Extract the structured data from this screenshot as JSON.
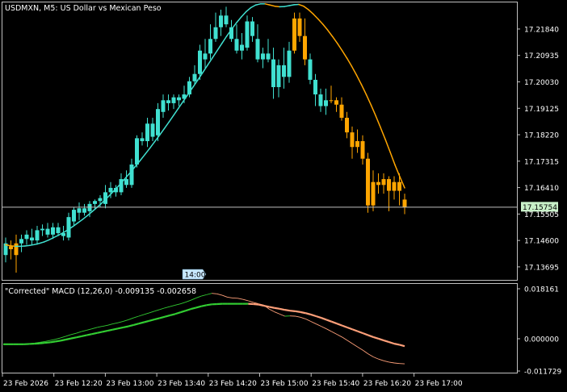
{
  "chart": {
    "title": "USDMXN, M5:  US Dollar vs Mexican Peso",
    "current_price_label": "17.15754",
    "current_price": 17.15754,
    "crosshair_time_label": "14:00",
    "price_ticks": [
      "17.21840",
      "17.20935",
      "17.20030",
      "17.19125",
      "17.18220",
      "17.17315",
      "17.16410",
      "17.15505",
      "17.14600",
      "17.13695"
    ],
    "time_ticks": [
      "23 Feb 2026",
      "23 Feb 12:20",
      "23 Feb 13:00",
      "23 Feb 13:40",
      "23 Feb 14:20",
      "23 Feb 15:00",
      "23 Feb 15:40",
      "23 Feb 16:20",
      "23 Feb 17:00"
    ]
  },
  "indicator": {
    "title": "\"Corrected\" MACD (12,26,0) -0.009135 -0.002658",
    "ticks": [
      "0.018161",
      "0.000000",
      "-0.011729"
    ]
  },
  "colors": {
    "background": "#000000",
    "bull": "#40e0d0",
    "bear": "#ffa500",
    "macd_line_up": "#32cd32",
    "macd_line_down": "#ffa07a",
    "border": "#c0c0c0",
    "price_label_bg": "#c8f0c8"
  },
  "chart_data": {
    "type": "candlestick",
    "price_range": [
      17.1325,
      17.2275
    ],
    "candles_ohlc": [
      [
        17.145,
        17.147,
        17.1385,
        17.141
      ],
      [
        17.144,
        17.146,
        17.1395,
        17.143
      ],
      [
        17.141,
        17.148,
        17.135,
        17.145
      ],
      [
        17.145,
        17.148,
        17.142,
        17.1465
      ],
      [
        17.1465,
        17.1495,
        17.1445,
        17.148
      ],
      [
        17.147,
        17.15,
        17.1445,
        17.146
      ],
      [
        17.146,
        17.151,
        17.1445,
        17.1495
      ],
      [
        17.1495,
        17.1515,
        17.1475,
        17.15
      ],
      [
        17.15,
        17.152,
        17.147,
        17.148
      ],
      [
        17.148,
        17.152,
        17.1465,
        17.1505
      ],
      [
        17.1505,
        17.152,
        17.1475,
        17.1485
      ],
      [
        17.1485,
        17.151,
        17.146,
        17.1475
      ],
      [
        17.147,
        17.1555,
        17.146,
        17.154
      ],
      [
        17.1525,
        17.1575,
        17.151,
        17.1565
      ],
      [
        17.1555,
        17.159,
        17.153,
        17.157
      ],
      [
        17.157,
        17.1585,
        17.1545,
        17.1555
      ],
      [
        17.156,
        17.1595,
        17.154,
        17.1585
      ],
      [
        17.1585,
        17.16,
        17.1565,
        17.1595
      ],
      [
        17.1595,
        17.1615,
        17.1575,
        17.1605
      ],
      [
        17.1585,
        17.165,
        17.157,
        17.1625
      ],
      [
        17.1625,
        17.166,
        17.1605,
        17.164
      ],
      [
        17.164,
        17.165,
        17.161,
        17.1625
      ],
      [
        17.1625,
        17.169,
        17.1615,
        17.167
      ],
      [
        17.167,
        17.17,
        17.164,
        17.165
      ],
      [
        17.165,
        17.174,
        17.164,
        17.172
      ],
      [
        17.172,
        17.182,
        17.171,
        17.181
      ],
      [
        17.181,
        17.183,
        17.1785,
        17.18
      ],
      [
        17.18,
        17.188,
        17.178,
        17.186
      ],
      [
        17.186,
        17.188,
        17.18,
        17.1815
      ],
      [
        17.182,
        17.193,
        17.18,
        17.191
      ],
      [
        17.19,
        17.196,
        17.188,
        17.194
      ],
      [
        17.194,
        17.196,
        17.1905,
        17.193
      ],
      [
        17.193,
        17.196,
        17.191,
        17.195
      ],
      [
        17.195,
        17.196,
        17.192,
        17.194
      ],
      [
        17.1945,
        17.199,
        17.193,
        17.196
      ],
      [
        17.196,
        17.202,
        17.195,
        17.2005
      ],
      [
        17.2005,
        17.206,
        17.1995,
        17.203
      ],
      [
        17.203,
        17.213,
        17.201,
        17.211
      ],
      [
        17.208,
        17.215,
        17.205,
        17.21
      ],
      [
        17.21,
        17.22,
        17.208,
        17.215
      ],
      [
        17.215,
        17.224,
        17.214,
        17.219
      ],
      [
        17.219,
        17.225,
        17.216,
        17.223
      ],
      [
        17.223,
        17.226,
        17.219,
        17.22
      ],
      [
        17.219,
        17.2215,
        17.214,
        17.215
      ],
      [
        17.215,
        17.22,
        17.21,
        17.211
      ],
      [
        17.211,
        17.217,
        17.208,
        17.213
      ],
      [
        17.212,
        17.223,
        17.211,
        17.221
      ],
      [
        17.221,
        17.2225,
        17.214,
        17.216
      ],
      [
        17.215,
        17.22,
        17.207,
        17.208
      ],
      [
        17.208,
        17.212,
        17.205,
        17.21
      ],
      [
        17.21,
        17.215,
        17.207,
        17.208
      ],
      [
        17.208,
        17.212,
        17.1945,
        17.1985
      ],
      [
        17.1985,
        17.208,
        17.195,
        17.206
      ],
      [
        17.206,
        17.212,
        17.198,
        17.202
      ],
      [
        17.202,
        17.214,
        17.2,
        17.211
      ],
      [
        17.211,
        17.224,
        17.21,
        17.222
      ],
      [
        17.222,
        17.224,
        17.214,
        17.216
      ],
      [
        17.216,
        17.222,
        17.206,
        17.208
      ],
      [
        17.208,
        17.21,
        17.1995,
        17.201
      ],
      [
        17.201,
        17.203,
        17.192,
        17.196
      ],
      [
        17.196,
        17.198,
        17.19,
        17.192
      ],
      [
        17.192,
        17.198,
        17.189,
        17.194
      ],
      [
        17.194,
        17.199,
        17.193,
        17.194
      ],
      [
        17.194,
        17.195,
        17.19,
        17.1925
      ],
      [
        17.1925,
        17.195,
        17.187,
        17.188
      ],
      [
        17.188,
        17.19,
        17.181,
        17.183
      ],
      [
        17.183,
        17.185,
        17.174,
        17.178
      ],
      [
        17.178,
        17.184,
        17.176,
        17.18
      ],
      [
        17.18,
        17.182,
        17.172,
        17.174
      ],
      [
        17.174,
        17.176,
        17.1555,
        17.158
      ],
      [
        17.158,
        17.17,
        17.156,
        17.166
      ],
      [
        17.166,
        17.169,
        17.162,
        17.165
      ],
      [
        17.165,
        17.169,
        17.162,
        17.167
      ],
      [
        17.167,
        17.168,
        17.156,
        17.163
      ],
      [
        17.163,
        17.168,
        17.16,
        17.166
      ],
      [
        17.166,
        17.169,
        17.158,
        17.163
      ],
      [
        17.16,
        17.162,
        17.155,
        17.1575
      ]
    ],
    "ma_values": [
      17.1445,
      17.1442,
      17.144,
      17.144,
      17.1441,
      17.1443,
      17.1446,
      17.145,
      17.1455,
      17.1462,
      17.147,
      17.1478,
      17.1487,
      17.1497,
      17.1508,
      17.152,
      17.1532,
      17.1545,
      17.1559,
      17.1573,
      17.1588,
      17.1604,
      17.1621,
      17.1638,
      17.1656,
      17.1675,
      17.1694,
      17.1714,
      17.1734,
      17.1755,
      17.1776,
      17.1798,
      17.182,
      17.1843,
      17.1866,
      17.189,
      17.1914,
      17.1938,
      17.1962,
      17.1986,
      17.201,
      17.2035,
      17.206,
      17.2085,
      17.211,
      17.2135,
      17.216,
      17.2183,
      17.2205,
      17.2225,
      17.2243,
      17.2257,
      17.2266,
      17.227,
      17.227,
      17.2266,
      17.2262,
      17.226,
      17.2261,
      17.2264,
      17.2267,
      17.2268,
      17.2262,
      17.225,
      17.2235,
      17.2218,
      17.22,
      17.218,
      17.2158,
      17.2135,
      17.211,
      17.2084,
      17.2056,
      17.2026,
      17.1994,
      17.196,
      17.1924,
      17.1886,
      17.1846,
      17.1805,
      17.1762,
      17.1718,
      17.1678,
      17.164
    ],
    "macd_range": [
      -0.011729,
      0.018161
    ],
    "macd_line": [
      -0.002,
      -0.002,
      -0.002,
      -0.002,
      -0.0019,
      -0.0018,
      -0.0016,
      -0.0013,
      -0.001,
      -0.0006,
      -0.0002,
      0.0003,
      0.0009,
      0.0015,
      0.002,
      0.0026,
      0.0031,
      0.0036,
      0.0041,
      0.0045,
      0.0049,
      0.0054,
      0.0058,
      0.0063,
      0.0069,
      0.0076,
      0.0082,
      0.0088,
      0.0094,
      0.01,
      0.0106,
      0.0112,
      0.0117,
      0.0122,
      0.0127,
      0.0133,
      0.014,
      0.0148,
      0.0155,
      0.016,
      0.0165,
      0.0163,
      0.0158,
      0.0151,
      0.0148,
      0.0147,
      0.0143,
      0.0138,
      0.0132,
      0.0127,
      0.0122,
      0.0108,
      0.0098,
      0.009,
      0.0082,
      0.0083,
      0.0082,
      0.0078,
      0.0072,
      0.0063,
      0.0054,
      0.0045,
      0.0036,
      0.0026,
      0.0016,
      0.0006,
      -0.0006,
      -0.0018,
      -0.003,
      -0.0042,
      -0.0055,
      -0.0066,
      -0.0074,
      -0.008,
      -0.0085,
      -0.0088,
      -0.009,
      -0.0091
    ],
    "signal_line": [
      -0.002,
      -0.002,
      -0.002,
      -0.002,
      -0.002,
      -0.0019,
      -0.0018,
      -0.0017,
      -0.0015,
      -0.0013,
      -0.001,
      -0.0007,
      -0.0003,
      0.0001,
      0.0005,
      0.0009,
      0.0013,
      0.0017,
      0.0021,
      0.0025,
      0.0029,
      0.0033,
      0.0037,
      0.0041,
      0.0045,
      0.005,
      0.0055,
      0.006,
      0.0065,
      0.007,
      0.0075,
      0.008,
      0.0085,
      0.009,
      0.0096,
      0.0102,
      0.0108,
      0.0113,
      0.0118,
      0.0122,
      0.0125,
      0.0126,
      0.0127,
      0.0127,
      0.0127,
      0.0127,
      0.0127,
      0.0127,
      0.0126,
      0.0124,
      0.012,
      0.0116,
      0.0112,
      0.0109,
      0.0105,
      0.0102,
      0.01,
      0.0097,
      0.0093,
      0.0088,
      0.0082,
      0.0076,
      0.0069,
      0.0062,
      0.0055,
      0.0048,
      0.0041,
      0.0034,
      0.0027,
      0.002,
      0.0013,
      0.0006,
      0.0,
      -0.0006,
      -0.0012,
      -0.0018,
      -0.0022,
      -0.0027
    ]
  }
}
